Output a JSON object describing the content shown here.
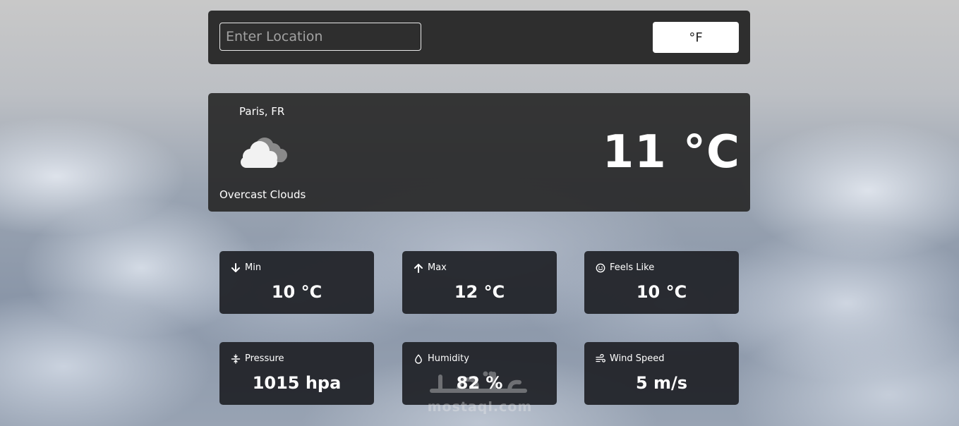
{
  "search": {
    "placeholder": "Enter Location",
    "value": "",
    "unit_toggle_label": "°F"
  },
  "current": {
    "city": "Paris, FR",
    "condition_icon": "overcast-clouds-icon",
    "description": "Overcast Clouds",
    "temperature": "11 °C"
  },
  "stats": [
    {
      "label": "Min",
      "value": "10 °C",
      "icon": "arrow-down-icon"
    },
    {
      "label": "Max",
      "value": "12 °C",
      "icon": "arrow-up-icon"
    },
    {
      "label": "Feels Like",
      "value": "10 °C",
      "icon": "smiley-icon"
    },
    {
      "label": "Pressure",
      "value": "1015 hpa",
      "icon": "pressure-icon"
    },
    {
      "label": "Humidity",
      "value": "82 %",
      "icon": "droplet-icon"
    },
    {
      "label": "Wind Speed",
      "value": "5 m/s",
      "icon": "wind-icon"
    }
  ],
  "watermark": {
    "text": "mostaql.com"
  },
  "colors": {
    "panel": "#282828",
    "card": "#212328",
    "text": "#ffffff",
    "button_bg": "#ffffff"
  }
}
